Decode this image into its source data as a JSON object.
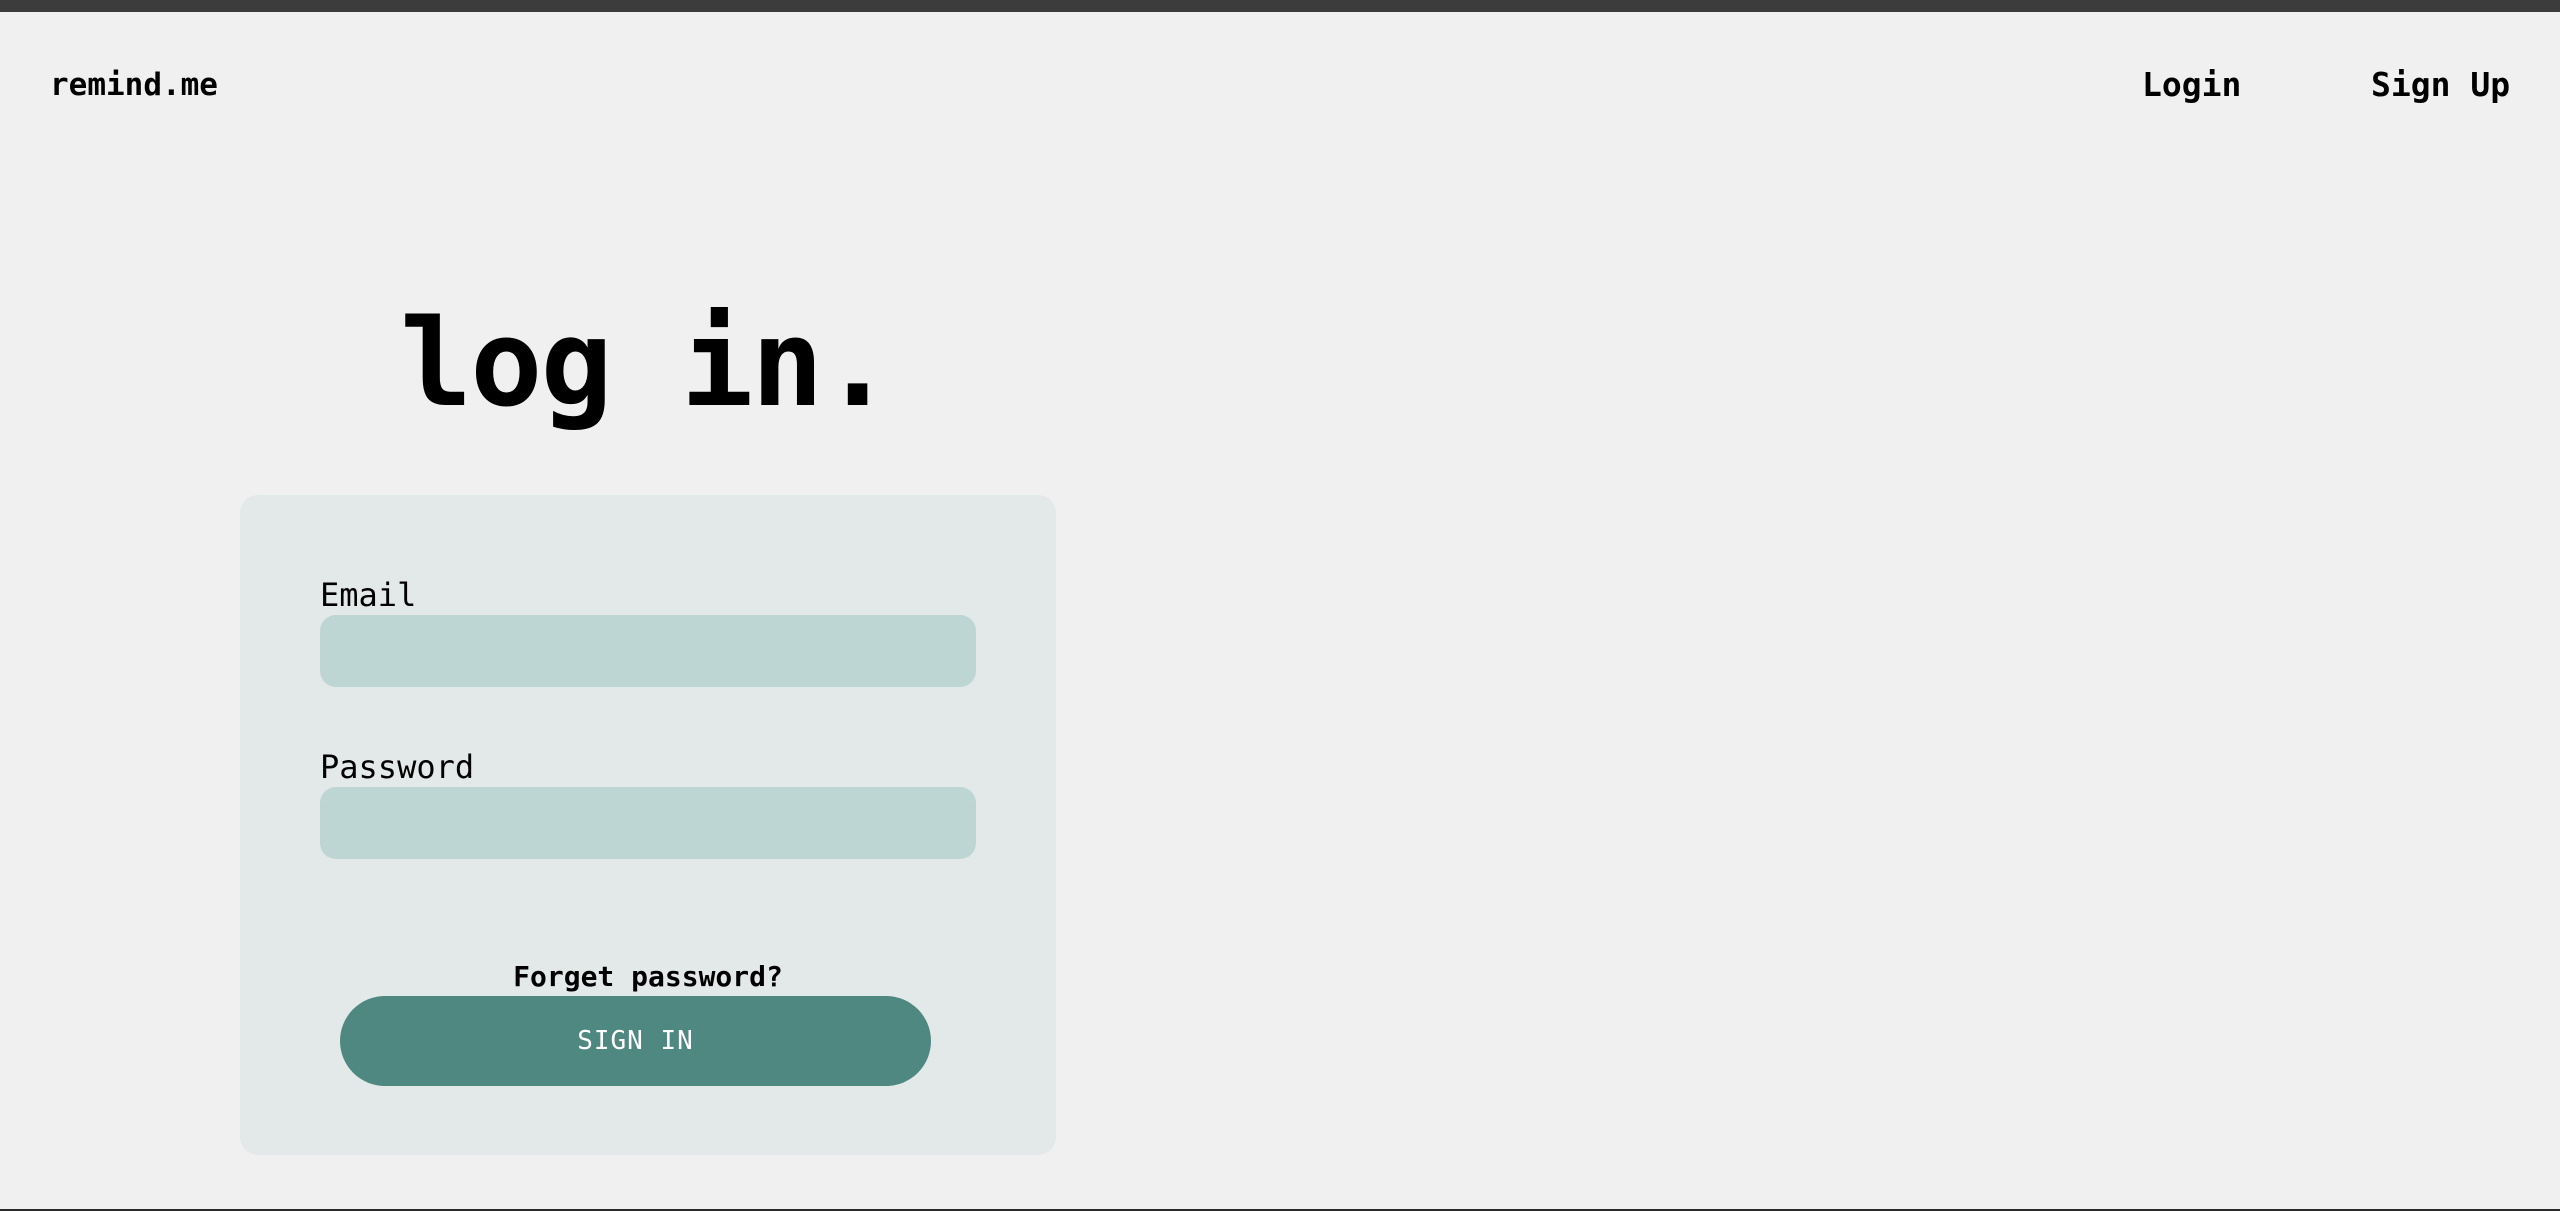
{
  "header": {
    "brand": "remind.me",
    "nav": {
      "login_label": "Login",
      "signup_label": "Sign Up"
    }
  },
  "main": {
    "title": "log in.",
    "form": {
      "email_label": "Email",
      "email_value": "",
      "password_label": "Password",
      "password_value": "",
      "forgot_label": "Forget password?",
      "submit_label": "SIGN IN"
    }
  },
  "colors": {
    "background": "#f0f0f0",
    "card": "#e3e9e8",
    "input": "#bed6d3",
    "accent": "#4e8880"
  }
}
